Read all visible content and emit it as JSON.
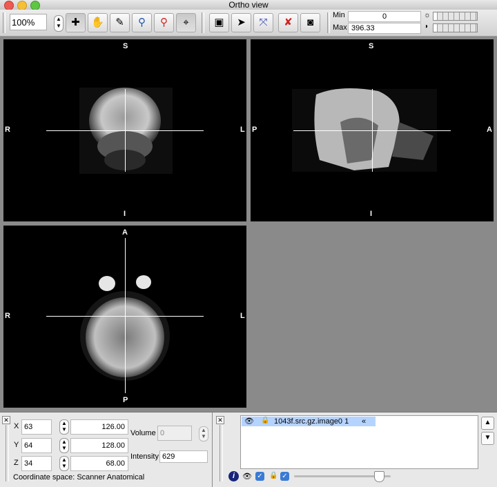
{
  "window": {
    "title": "Ortho view"
  },
  "toolbar": {
    "zoom_value": "100%",
    "tools": [
      "crosshair-cursor-icon",
      "hand-pan-icon",
      "pencil-icon",
      "zoom-magnifier-icon",
      "zoom-out-magnifier-icon",
      "locate-target-icon",
      "chip-icon",
      "gesture-icon",
      "axes-icon",
      "no-pencil-icon",
      "binoculars-icon"
    ],
    "min_label": "Min",
    "min_value": "0",
    "max_label": "Max",
    "max_value": "396.33"
  },
  "views": {
    "coronal": {
      "top": "S",
      "bottom": "I",
      "left": "R",
      "right": "L"
    },
    "sagittal": {
      "top": "S",
      "bottom": "I",
      "left": "P",
      "right": "A"
    },
    "axial": {
      "top": "A",
      "bottom": "P",
      "left": "R",
      "right": "L"
    }
  },
  "location": {
    "x_label": "X",
    "x_voxel": "63",
    "x_world": "126.00",
    "y_label": "Y",
    "y_voxel": "64",
    "y_world": "128.00",
    "z_label": "Z",
    "z_voxel": "34",
    "z_world": "68.00",
    "volume_label": "Volume",
    "volume_value": "0",
    "intensity_label": "Intensity",
    "intensity_value": "629",
    "coordinate_space": "Coordinate space: Scanner Anatomical"
  },
  "overlays": {
    "items": [
      {
        "name": "1043f.src.gz.image0 1",
        "visible": true,
        "locked": true
      }
    ],
    "opacity_fraction": 0.88
  },
  "colors": {
    "accent": "#3a7bd5",
    "selection": "#b5d3ff",
    "canvas_bg": "#8a8a8a"
  }
}
